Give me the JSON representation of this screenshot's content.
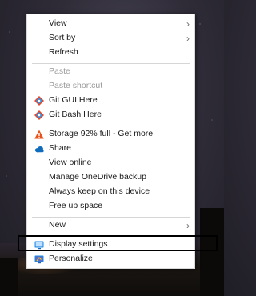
{
  "menu": {
    "view": "View",
    "sort_by": "Sort by",
    "refresh": "Refresh",
    "paste": "Paste",
    "paste_shortcut": "Paste shortcut",
    "git_gui": "Git GUI Here",
    "git_bash": "Git Bash Here",
    "storage": "Storage 92% full - Get more",
    "share": "Share",
    "view_online": "View online",
    "manage_backup": "Manage OneDrive backup",
    "always_keep": "Always keep on this device",
    "free_up": "Free up space",
    "new": "New",
    "display_settings": "Display settings",
    "personalize": "Personalize"
  },
  "icons": {
    "chevron": "›",
    "git": "git-icon",
    "warning": "warning-icon",
    "onedrive": "onedrive-icon",
    "display": "display-icon",
    "personalize": "personalize-icon"
  },
  "colors": {
    "git_red": "#e8472d",
    "git_blue": "#3a8fd9",
    "warning_orange": "#e8531b",
    "onedrive_blue": "#0f6cbd",
    "display_blue": "#1e88e5",
    "highlight_border": "#000000",
    "disabled_text": "#9a9a9a"
  }
}
